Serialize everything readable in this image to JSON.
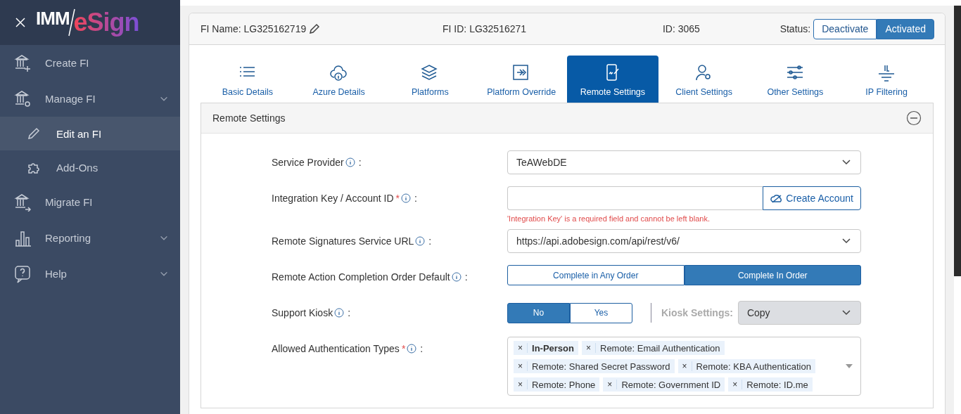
{
  "sidebar": {
    "logo": {
      "left": "IMM",
      "right": "eSign"
    },
    "items": [
      {
        "label": "Create FI",
        "selected": false,
        "has_submenu": false
      },
      {
        "label": "Manage FI",
        "selected": false,
        "has_submenu": true,
        "children": [
          {
            "label": "Edit an FI",
            "selected": true
          },
          {
            "label": "Add-Ons",
            "selected": false
          }
        ]
      },
      {
        "label": "Migrate FI",
        "selected": false,
        "has_submenu": false
      },
      {
        "label": "Reporting",
        "selected": false,
        "has_submenu": true
      },
      {
        "label": "Help",
        "selected": false,
        "has_submenu": true
      }
    ]
  },
  "header": {
    "fi_name": "FI Name: LG325162719",
    "fi_id": "FI ID: LG32516271",
    "id": "ID: 3065",
    "status_label": "Status:",
    "status_options": [
      {
        "label": "Deactivate",
        "selected": false
      },
      {
        "label": "Activated",
        "selected": true
      }
    ]
  },
  "tabs": [
    {
      "label": "Basic Details",
      "selected": false
    },
    {
      "label": "Azure Details",
      "selected": false
    },
    {
      "label": "Platforms",
      "selected": false
    },
    {
      "label": "Platform Override",
      "selected": false
    },
    {
      "label": "Remote Settings",
      "selected": true
    },
    {
      "label": "Client Settings",
      "selected": false
    },
    {
      "label": "Other Settings",
      "selected": false
    },
    {
      "label": "IP Filtering",
      "selected": false
    }
  ],
  "panel": {
    "title": "Remote Settings",
    "expanded": true,
    "rows": [
      {
        "kind": "select",
        "label": "Service Provider",
        "suffix": ":",
        "value": "TeAWebDE"
      },
      {
        "kind": "input-button",
        "label": "Integration Key / Account ID",
        "required_mark": "*",
        "suffix": ":",
        "button": "Create Account",
        "error": "'Integration Key' is a required field and cannot be left blank."
      },
      {
        "kind": "select",
        "label": "Remote Signatures Service URL",
        "suffix": ":",
        "value": "https://api.adobesign.com/api/rest/v6/"
      },
      {
        "kind": "segmented",
        "label": "Remote Action Completion Order Default",
        "suffix": ":",
        "options": [
          {
            "label": "Complete in Any Order",
            "selected": false
          },
          {
            "label": "Complete In Order",
            "selected": true
          }
        ]
      },
      {
        "kind": "kiosk",
        "label": "Support Kiosk",
        "suffix": ":",
        "options": [
          {
            "label": "No",
            "selected": true
          },
          {
            "label": "Yes",
            "selected": false
          }
        ],
        "settings_label": "Kiosk Settings:",
        "settings_value": "Copy",
        "settings_disabled": true
      },
      {
        "kind": "tags",
        "label": "Allowed Authentication Types",
        "required_mark": "*",
        "suffix": ":",
        "tags": [
          {
            "remove": "×",
            "label": "In-Person",
            "bold": true
          },
          {
            "remove": "×",
            "label": "Remote: Email Authentication",
            "bold": false
          },
          {
            "remove": "×",
            "label": "Remote: Shared Secret Password",
            "bold": false
          },
          {
            "remove": "×",
            "label": "Remote: KBA Authentication",
            "bold": false
          },
          {
            "remove": "×",
            "label": "Remote: Phone",
            "bold": false
          },
          {
            "remove": "×",
            "label": "Remote: Government ID",
            "bold": false
          },
          {
            "remove": "×",
            "label": "Remote: ID.me",
            "bold": false
          }
        ]
      }
    ]
  }
}
